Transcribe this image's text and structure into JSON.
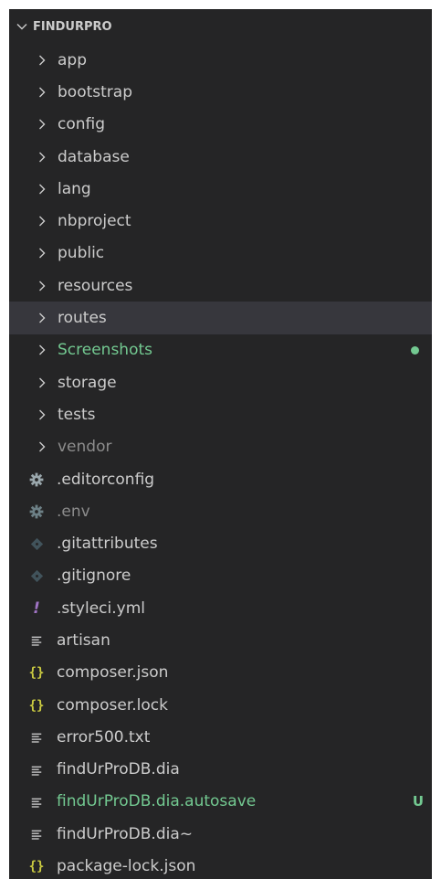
{
  "explorer": {
    "title": "FINDURPRO",
    "folders": [
      {
        "label": "app",
        "status": "normal"
      },
      {
        "label": "bootstrap",
        "status": "normal"
      },
      {
        "label": "config",
        "status": "normal"
      },
      {
        "label": "database",
        "status": "normal"
      },
      {
        "label": "lang",
        "status": "normal"
      },
      {
        "label": "nbproject",
        "status": "normal"
      },
      {
        "label": "public",
        "status": "normal"
      },
      {
        "label": "resources",
        "status": "normal"
      },
      {
        "label": "routes",
        "status": "selected"
      },
      {
        "label": "Screenshots",
        "status": "untracked"
      },
      {
        "label": "storage",
        "status": "normal"
      },
      {
        "label": "tests",
        "status": "normal"
      },
      {
        "label": "vendor",
        "status": "ignored"
      }
    ],
    "files": [
      {
        "label": ".editorconfig",
        "icon": "gear-icon",
        "status": "normal"
      },
      {
        "label": ".env",
        "icon": "gear-icon",
        "status": "ignored"
      },
      {
        "label": ".gitattributes",
        "icon": "git-icon",
        "status": "normal"
      },
      {
        "label": ".gitignore",
        "icon": "git-icon",
        "status": "normal"
      },
      {
        "label": ".styleci.yml",
        "icon": "yaml-icon",
        "status": "normal"
      },
      {
        "label": "artisan",
        "icon": "text-file-icon",
        "status": "normal"
      },
      {
        "label": "composer.json",
        "icon": "json-icon",
        "status": "normal"
      },
      {
        "label": "composer.lock",
        "icon": "json-icon",
        "status": "normal"
      },
      {
        "label": "error500.txt",
        "icon": "text-file-icon",
        "status": "normal"
      },
      {
        "label": "findUrProDB.dia",
        "icon": "text-file-icon",
        "status": "normal"
      },
      {
        "label": "findUrProDB.dia.autosave",
        "icon": "text-file-icon",
        "status": "untracked",
        "badge": "U"
      },
      {
        "label": "findUrProDB.dia~",
        "icon": "text-file-icon",
        "status": "normal"
      },
      {
        "label": "package-lock.json",
        "icon": "json-icon",
        "status": "normal"
      }
    ],
    "colors": {
      "background": "#252526",
      "selected": "#37373d",
      "untracked": "#73c991",
      "ignored": "#8c8c8c",
      "json": "#cbcb41",
      "yaml": "#a074c4"
    }
  }
}
